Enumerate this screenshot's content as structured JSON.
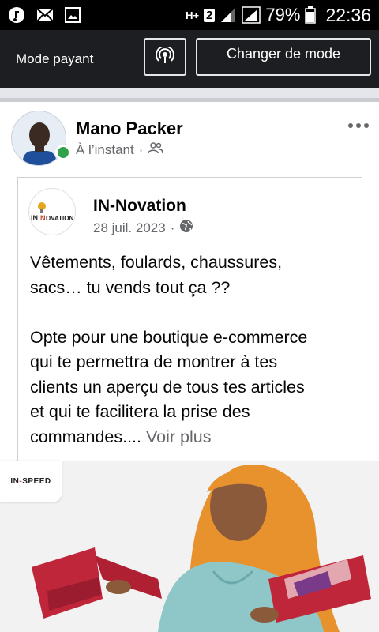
{
  "status_bar": {
    "left_icons": [
      "music-icon",
      "mail-icon",
      "image-icon"
    ],
    "network_type": "H+",
    "sim_badge": "2",
    "battery_percent": "79%",
    "time": "22:36"
  },
  "action_bar": {
    "mode_label": "Mode payant",
    "broadcast_icon": "broadcast-icon",
    "change_mode_label": "Changer de mode"
  },
  "post": {
    "author": "Mano Packer",
    "timestamp": "À l’instant",
    "separator": "·",
    "audience_icon": "friends-icon",
    "more_icon": "more-options-icon"
  },
  "shared": {
    "page_name": "IN-Novation",
    "date": "28 juil. 2023",
    "separator": "·",
    "audience_icon": "globe-icon",
    "text_line1": "Vêtements, foulards, chaussures,",
    "text_line2": "sacs… tu vends tout ça ??",
    "text_line3": "Opte pour une boutique e-commerce",
    "text_line4": "qui te permettra de montrer à tes",
    "text_line5": "clients un aperçu de tous tes articles",
    "text_line6": "et qui te facilitera la prise des",
    "text_line7": "commandes....",
    "see_more": "Voir plus",
    "logo_text": "IN NOVATION"
  },
  "image": {
    "brand_prefix": "IN",
    "brand_suffix": "SPEED"
  }
}
